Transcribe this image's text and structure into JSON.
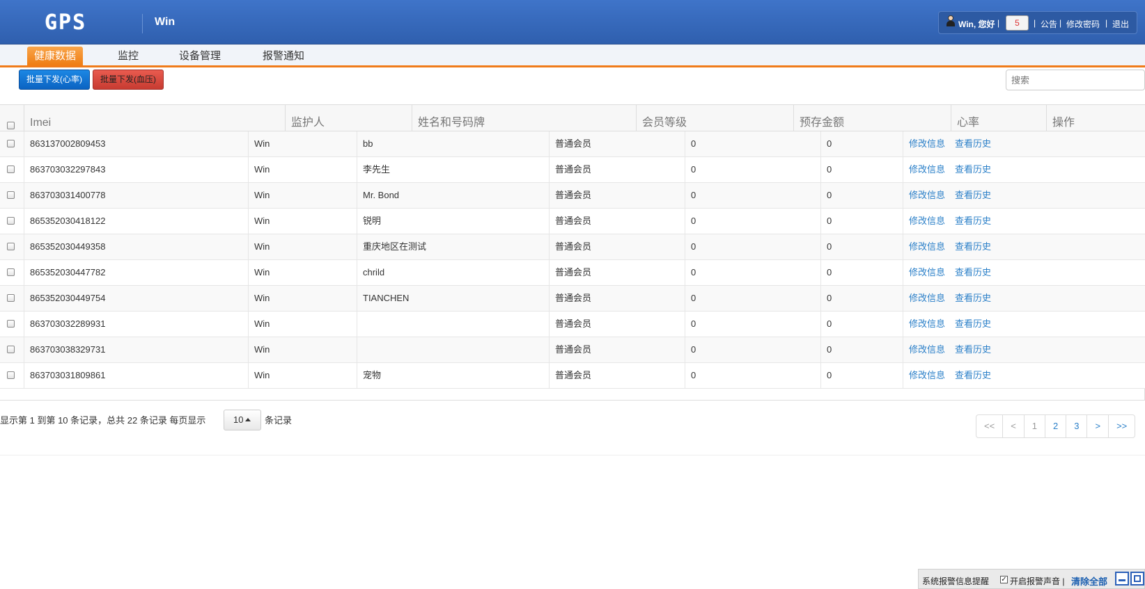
{
  "header": {
    "logo": "GPS",
    "app_title": "Win",
    "greeting": "Win, 您好",
    "notification_count": "5",
    "links": [
      "公告",
      "修改密码",
      "退出"
    ]
  },
  "nav": {
    "tabs": [
      "健康数据",
      "监控",
      "设备管理",
      "报警通知"
    ],
    "active_tab": "健康数据"
  },
  "toolbar": {
    "batch_heart_rate": "批量下发(心率)",
    "batch_blood_pressure": "批量下发(血压)",
    "search_placeholder": "搜索"
  },
  "table": {
    "columns": [
      "Imei",
      "监护人",
      "姓名和号码牌",
      "会员等级",
      "预存金额",
      "心率",
      "操作"
    ],
    "action_edit": "修改信息",
    "action_history": "查看历史",
    "rows": [
      {
        "imei": "863137002809453",
        "guardian": "Win",
        "name": "bb",
        "level": "普通会员",
        "balance": "0",
        "heart_rate": "0"
      },
      {
        "imei": "863703032297843",
        "guardian": "Win",
        "name": "李先生",
        "level": "普通会员",
        "balance": "0",
        "heart_rate": "0"
      },
      {
        "imei": "863703031400778",
        "guardian": "Win",
        "name": "Mr. Bond",
        "level": "普通会员",
        "balance": "0",
        "heart_rate": "0"
      },
      {
        "imei": "865352030418122",
        "guardian": "Win",
        "name": "锐明",
        "level": "普通会员",
        "balance": "0",
        "heart_rate": "0"
      },
      {
        "imei": "865352030449358",
        "guardian": "Win",
        "name": "重庆地区在测试",
        "level": "普通会员",
        "balance": "0",
        "heart_rate": "0"
      },
      {
        "imei": "865352030447782",
        "guardian": "Win",
        "name": "chrild",
        "level": "普通会员",
        "balance": "0",
        "heart_rate": "0"
      },
      {
        "imei": "865352030449754",
        "guardian": "Win",
        "name": "TIANCHEN",
        "level": "普通会员",
        "balance": "0",
        "heart_rate": "0"
      },
      {
        "imei": "863703032289931",
        "guardian": "Win",
        "name": "",
        "level": "普通会员",
        "balance": "0",
        "heart_rate": "0"
      },
      {
        "imei": "863703038329731",
        "guardian": "Win",
        "name": "",
        "level": "普通会员",
        "balance": "0",
        "heart_rate": "0"
      },
      {
        "imei": "863703031809861",
        "guardian": "Win",
        "name": "宠物",
        "level": "普通会员",
        "balance": "0",
        "heart_rate": "0"
      }
    ]
  },
  "pagination": {
    "info_prefix": "显示第 1 到第 10 条记录，总共 22 条记录 每页显示",
    "page_size": "10",
    "info_suffix": "条记录",
    "buttons": [
      "<<",
      "<",
      "1",
      "2",
      "3",
      ">",
      ">>"
    ]
  },
  "alert_bar": {
    "title": "系统报警信息提醒",
    "sound_label": "开启报警声音 |",
    "clear_all": "清除全部"
  }
}
